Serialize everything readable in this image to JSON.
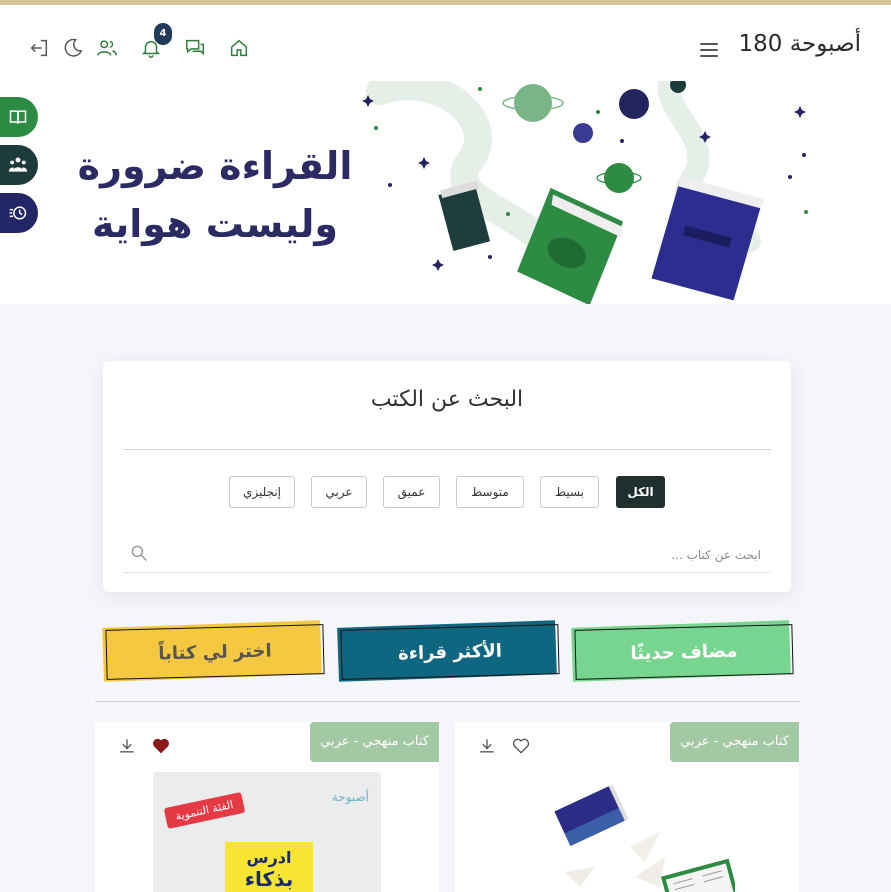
{
  "header": {
    "brand": "أصبوحة 180",
    "notification_count": "4",
    "icons": [
      "home-icon",
      "chat-icon",
      "bell-icon",
      "users-icon",
      "moon-icon",
      "logout-icon"
    ]
  },
  "hero": {
    "title_line1": "القراءة ضرورة",
    "title_line2": "وليست هواية"
  },
  "sidebar": {
    "buttons": [
      {
        "name": "read-book-icon",
        "color": "#2e8b43"
      },
      {
        "name": "community-icon",
        "color": "#1e3b3c"
      },
      {
        "name": "history-icon",
        "color": "#222566"
      }
    ]
  },
  "search": {
    "title": "البحث عن الكتب",
    "filters": [
      "الكل",
      "بسيط",
      "متوسط",
      "عميق",
      "عربي",
      "إنجليزي"
    ],
    "active_filter": "الكل",
    "placeholder": "ابحث عن كتاب ..."
  },
  "categories": [
    {
      "label": "مضاف حديثًا",
      "bg": "#77d58f",
      "text": "#ffffff"
    },
    {
      "label": "الأكثر قراءة",
      "bg": "#0e6680",
      "text": "#ffffff"
    },
    {
      "label": "اختر لي كتاباً",
      "bg": "#f5c842",
      "text": "#555555"
    }
  ],
  "books": [
    {
      "tag": "كتاب منهجي - عربي",
      "liked": false
    },
    {
      "tag": "كتاب منهجي - عربي",
      "liked": true,
      "cover_badge": "الفئة التنموية",
      "cover_title_1": "ادرس",
      "cover_title_2": "بذكاء",
      "cover_logo": "أصبوحة"
    }
  ]
}
